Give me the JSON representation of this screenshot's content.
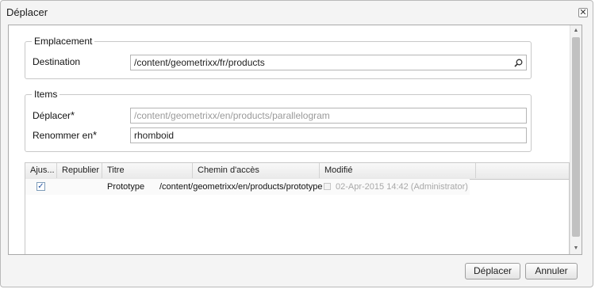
{
  "dialog": {
    "title": "Déplacer",
    "close_glyph": "✕"
  },
  "emplacement": {
    "legend": "Emplacement",
    "destination_label": "Destination",
    "destination_value": "/content/geometrixx/fr/products",
    "search_icon": "search-icon"
  },
  "items": {
    "legend": "Items",
    "deplacer_label": "Déplacer",
    "deplacer_value": "/content/geometrixx/en/products/parallelogram",
    "renommer_label": "Renommer en",
    "renommer_value": "rhomboid",
    "required_marker": "*"
  },
  "grid": {
    "columns": [
      "Ajus...",
      "Republier",
      "Titre",
      "Chemin d'accès",
      "Modifié"
    ],
    "rows": [
      {
        "ajuster_checked": true,
        "check_glyph": "✓",
        "republier": "",
        "titre": "Prototype",
        "chemin": "/content/geometrixx/en/products/prototype",
        "modifie": "02-Apr-2015 14:42 (Administrator)"
      }
    ]
  },
  "buttons": {
    "move": "Déplacer",
    "cancel": "Annuler"
  },
  "scrollbar": {
    "up_glyph": "▲",
    "down_glyph": "▼"
  },
  "colors": {
    "accent_check": "#1f4fa0",
    "disabled_text": "#9a9a9a"
  }
}
